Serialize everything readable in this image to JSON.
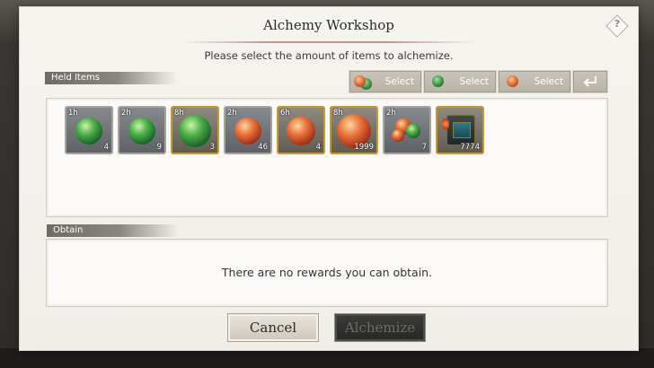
{
  "dialog": {
    "title": "Alchemy Workshop",
    "subtitle": "Please select the amount of items to alchemize.",
    "help_icon": "question-icon"
  },
  "held_items": {
    "label": "Held Items",
    "select_buttons": [
      {
        "label": "Select",
        "icon": "mixed-orb-icon"
      },
      {
        "label": "Select",
        "icon": "green-orb-icon"
      },
      {
        "label": "Select",
        "icon": "red-orb-icon"
      }
    ],
    "reset_icon": "return-arrow-icon",
    "items": [
      {
        "time": "1h",
        "qty": "4",
        "type": "green-orb",
        "rarity": "silver"
      },
      {
        "time": "2h",
        "qty": "9",
        "type": "green-orb",
        "rarity": "silver"
      },
      {
        "time": "8h",
        "qty": "3",
        "type": "green-orb",
        "rarity": "gold"
      },
      {
        "time": "2h",
        "qty": "46",
        "type": "red-orb",
        "rarity": "silver"
      },
      {
        "time": "6h",
        "qty": "4",
        "type": "red-orb",
        "rarity": "gold"
      },
      {
        "time": "8h",
        "qty": "1999",
        "type": "red-orb",
        "rarity": "gold"
      },
      {
        "time": "2h",
        "qty": "7",
        "type": "mixed-orbs",
        "rarity": "silver"
      },
      {
        "time": "",
        "qty": "7774",
        "type": "lantern",
        "rarity": "gold"
      }
    ]
  },
  "obtain": {
    "label": "Obtain",
    "empty_message": "There are no rewards you can obtain."
  },
  "buttons": {
    "cancel": "Cancel",
    "alchemize": "Alchemize"
  },
  "colors": {
    "gold_frame": "#c69a2c",
    "silver_frame": "#a7a39d",
    "dialog_bg": "#f6f4ef",
    "alchemize_disabled": "#262724"
  }
}
